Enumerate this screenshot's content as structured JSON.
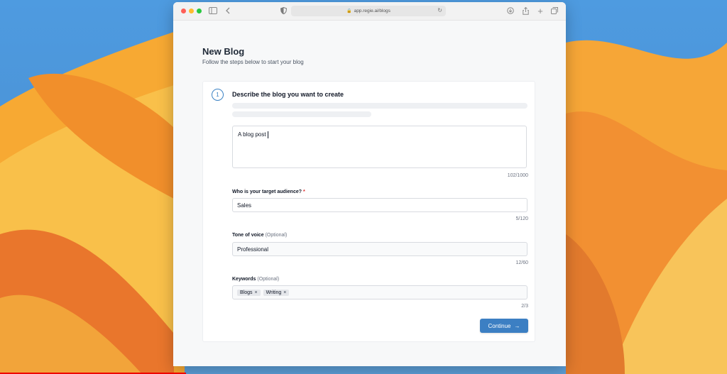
{
  "browser": {
    "url": "app.regie.ai/blogs"
  },
  "page": {
    "title": "New Blog",
    "subtitle": "Follow the steps below to start your blog"
  },
  "step": {
    "number": "1",
    "title": "Describe the blog you want to create"
  },
  "description": {
    "value": "A blog post",
    "counter": "102/1000"
  },
  "audience": {
    "label": "Who is your target audience?",
    "required_mark": "*",
    "value": "Sales",
    "counter": "5/120"
  },
  "tone": {
    "label": "Tone of voice",
    "optional": "(Optional)",
    "value": "Professional",
    "counter": "12/60"
  },
  "keywords": {
    "label": "Keywords",
    "optional": "(Optional)",
    "chips": [
      "Blogs",
      "Writing"
    ],
    "remove_glyph": "×",
    "counter": "2/3"
  },
  "actions": {
    "continue_label": "Continue",
    "continue_arrow": "→"
  },
  "icons": {
    "sidebar": "sidebar-toggle-icon",
    "back": "chevron-left-icon",
    "shield": "shield-icon",
    "lock": "lock-icon",
    "reload": "reload-icon",
    "download": "download-icon",
    "share": "share-icon",
    "new_tab": "plus-icon",
    "tabs": "tab-overview-icon"
  },
  "colors": {
    "accent": "#3c7fc3",
    "required": "#dc2626"
  }
}
